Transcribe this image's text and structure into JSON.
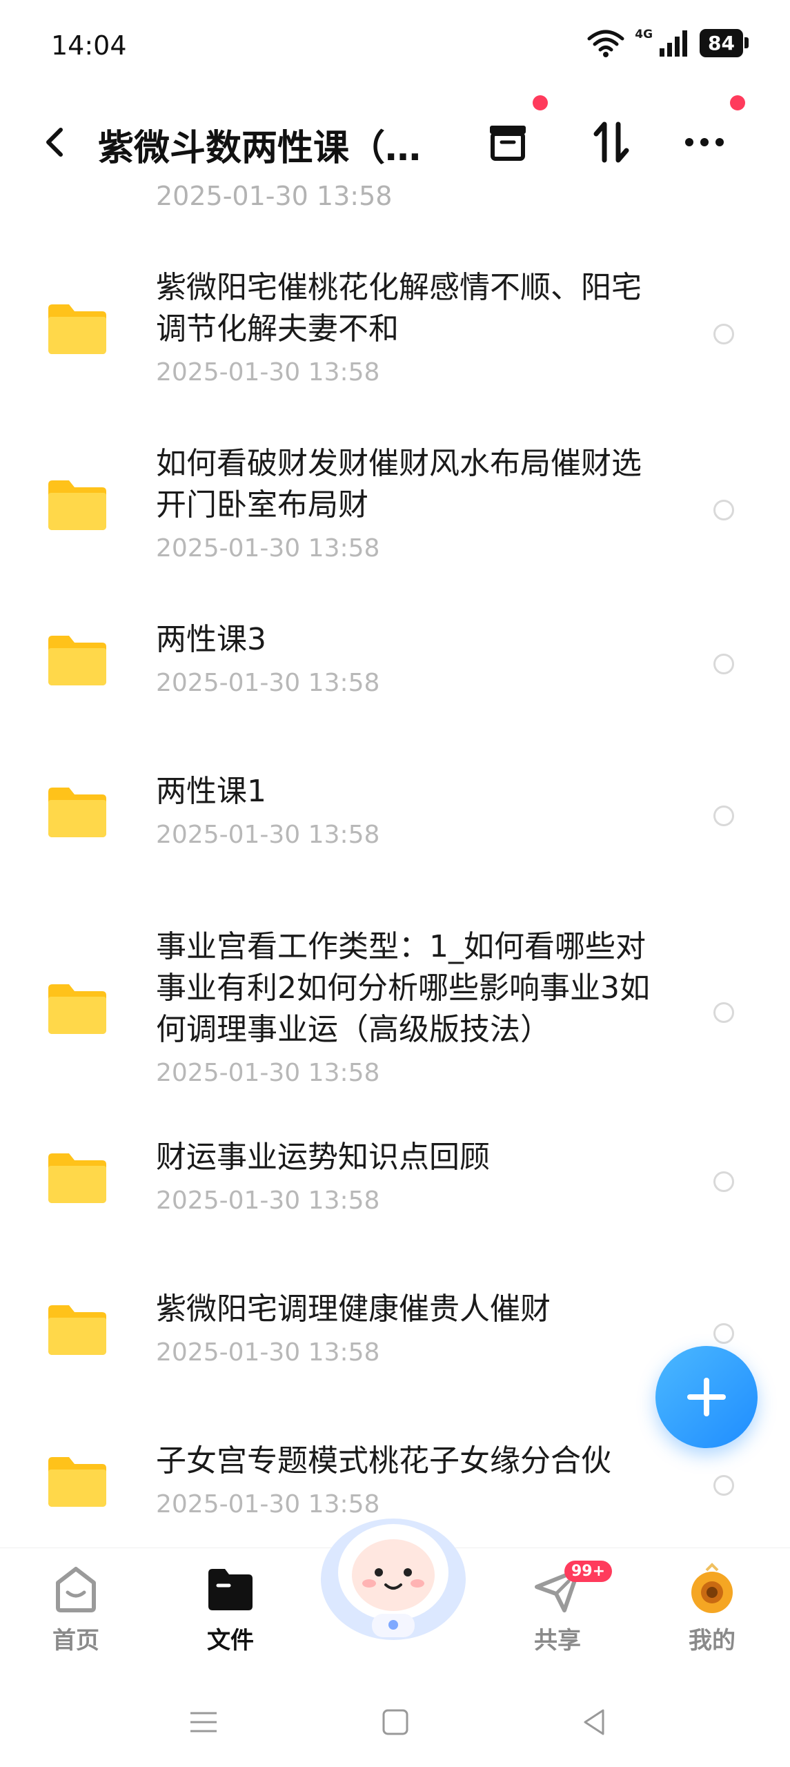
{
  "status_bar": {
    "time": "14:04",
    "network": "4G",
    "battery": "84"
  },
  "header": {
    "title": "紫微斗数两性课（…"
  },
  "list": {
    "partial_date": "2025-01-30   13:58",
    "items": [
      {
        "name": "紫微阳宅催桃花化解感情不顺、阳宅调节化解夫妻不和",
        "date": "2025-01-30   13:58"
      },
      {
        "name": "如何看破财发财催财风水布局催财选开门卧室布局财",
        "date": "2025-01-30   13:58"
      },
      {
        "name": "两性课3",
        "date": "2025-01-30   13:58"
      },
      {
        "name": "两性课1",
        "date": "2025-01-30   13:58"
      },
      {
        "name": "事业宫看工作类型：1_如何看哪些对事业有利2如何分析哪些影响事业3如何调理事业运（高级版技法）",
        "date": "2025-01-30   13:58"
      },
      {
        "name": "财运事业运势知识点回顾",
        "date": "2025-01-30   13:58"
      },
      {
        "name": "紫微阳宅调理健康催贵人催财",
        "date": "2025-01-30   13:58"
      },
      {
        "name": "子女宫专题模式桃花子女缘分合伙",
        "date": "2025-01-30   13:58"
      }
    ]
  },
  "bottom_nav": {
    "home": "首页",
    "files": "文件",
    "share": "共享",
    "share_badge": "99+",
    "mine": "我的"
  },
  "colors": {
    "accent": "#1f8dff",
    "folder": "#ffd02e",
    "badge": "#ff3b5c"
  },
  "icons": [
    "back-icon",
    "archive-icon",
    "sort-icon",
    "more-icon",
    "folder-icon",
    "plus-icon",
    "home-icon",
    "file-icon",
    "share-icon",
    "avatar-icon"
  ]
}
